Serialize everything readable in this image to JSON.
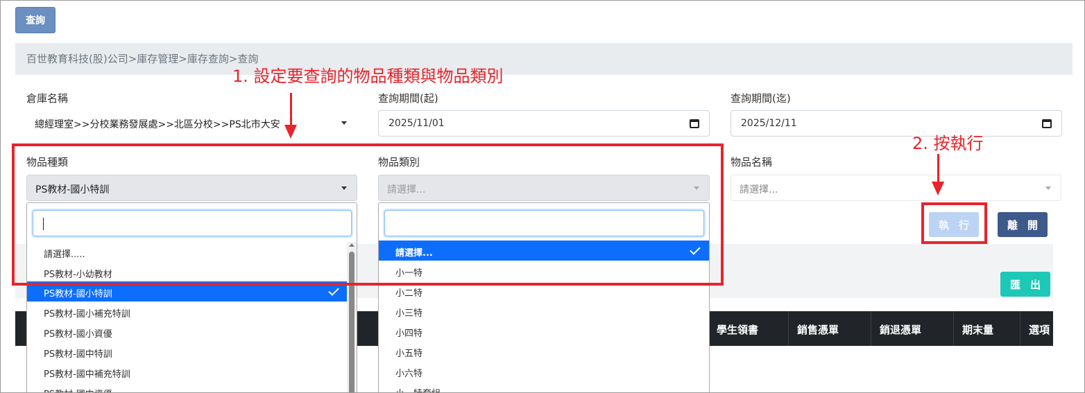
{
  "toolbar": {
    "query_label": "查詢"
  },
  "breadcrumb": "百世教育科技(股)公司>庫存管理>庫存查詢>查詢",
  "filters": {
    "warehouse": {
      "label": "倉庫名稱",
      "value": "總經理室>>分校業務發展處>>北區分校>>PS北市大安"
    },
    "period_start": {
      "label": "查詢期間(起)",
      "value": "2025/11/01"
    },
    "period_end": {
      "label": "查詢期間(迄)",
      "value": "2025/12/11"
    },
    "item_type": {
      "label": "物品種類",
      "value": "PS教材-國小特訓"
    },
    "item_category": {
      "label": "物品類別",
      "placeholder": "請選擇..."
    },
    "item_name": {
      "label": "物品名稱",
      "placeholder": "請選擇..."
    }
  },
  "item_type_dropdown": {
    "options": [
      "請選擇.....",
      "PS教材-小幼教材",
      "PS教材-國小特訓",
      "PS教材-國小補充特訓",
      "PS教材-國小資優",
      "PS教材-國中特訓",
      "PS教材-國中補充特訓",
      "PS教材-國中資優"
    ],
    "selected_index": 2
  },
  "item_category_dropdown": {
    "options": [
      "請選擇...",
      "小一特",
      "小二特",
      "小三特",
      "小四特",
      "小五特",
      "小六特",
      "小一特套組"
    ],
    "selected_index": 0
  },
  "buttons": {
    "execute": "執行",
    "leave": "離開",
    "export": "匯出"
  },
  "table": {
    "columns": [
      "學生領書",
      "銷售憑單",
      "銷退憑單",
      "期末量",
      "選項"
    ]
  },
  "annotations": {
    "step1": "1. 設定要查詢的物品種類與物品類別",
    "step2": "2. 按執行"
  },
  "colors": {
    "annotation": "#e8232a",
    "selected": "#0d6efd",
    "table_header": "#212529"
  }
}
